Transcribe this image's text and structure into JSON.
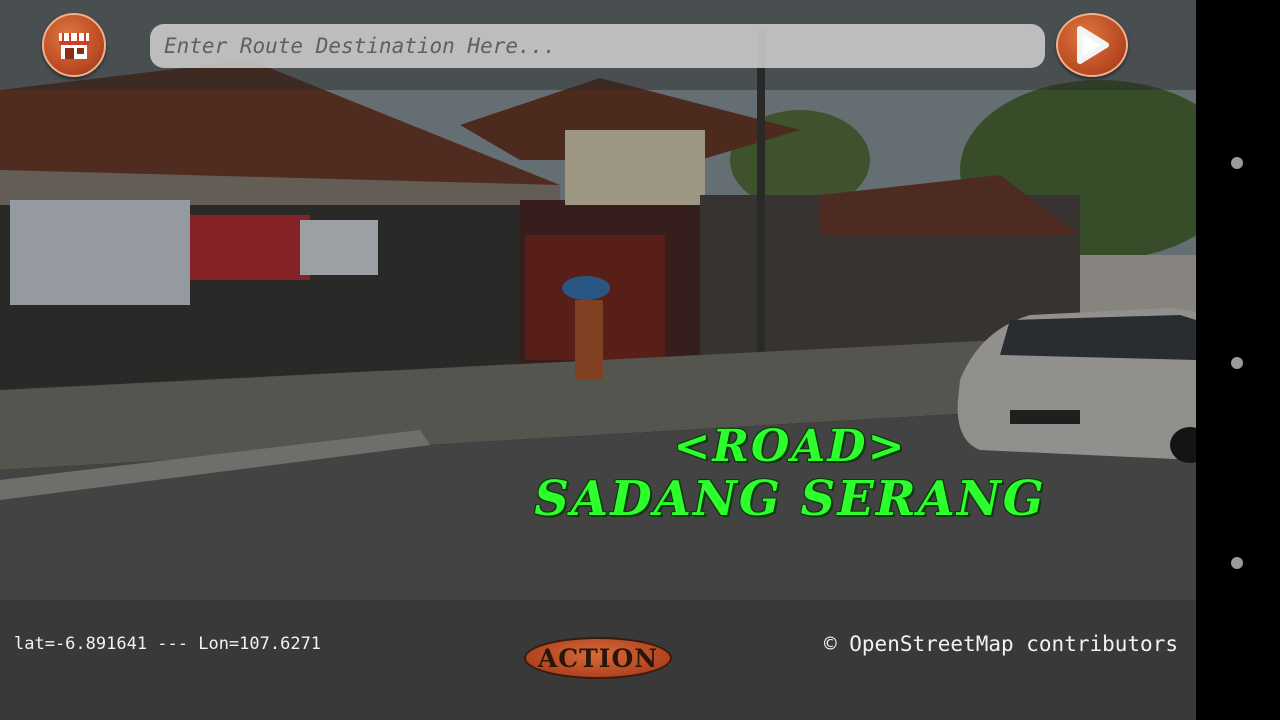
{
  "search": {
    "placeholder": "Enter Route Destination Here..."
  },
  "road": {
    "line1": "<ROAD>",
    "line2": "SADANG SERANG"
  },
  "status": {
    "coords": "lat=-6.891641 --- Lon=107.6271",
    "credits": "© OpenStreetMap contributors"
  },
  "buttons": {
    "action_label": "ACTION"
  },
  "icons": {
    "shop": "shop-icon",
    "play": "play-icon"
  },
  "colors": {
    "road_text": "#2dff2d",
    "button": "#c4552b",
    "bar": "#373737"
  }
}
